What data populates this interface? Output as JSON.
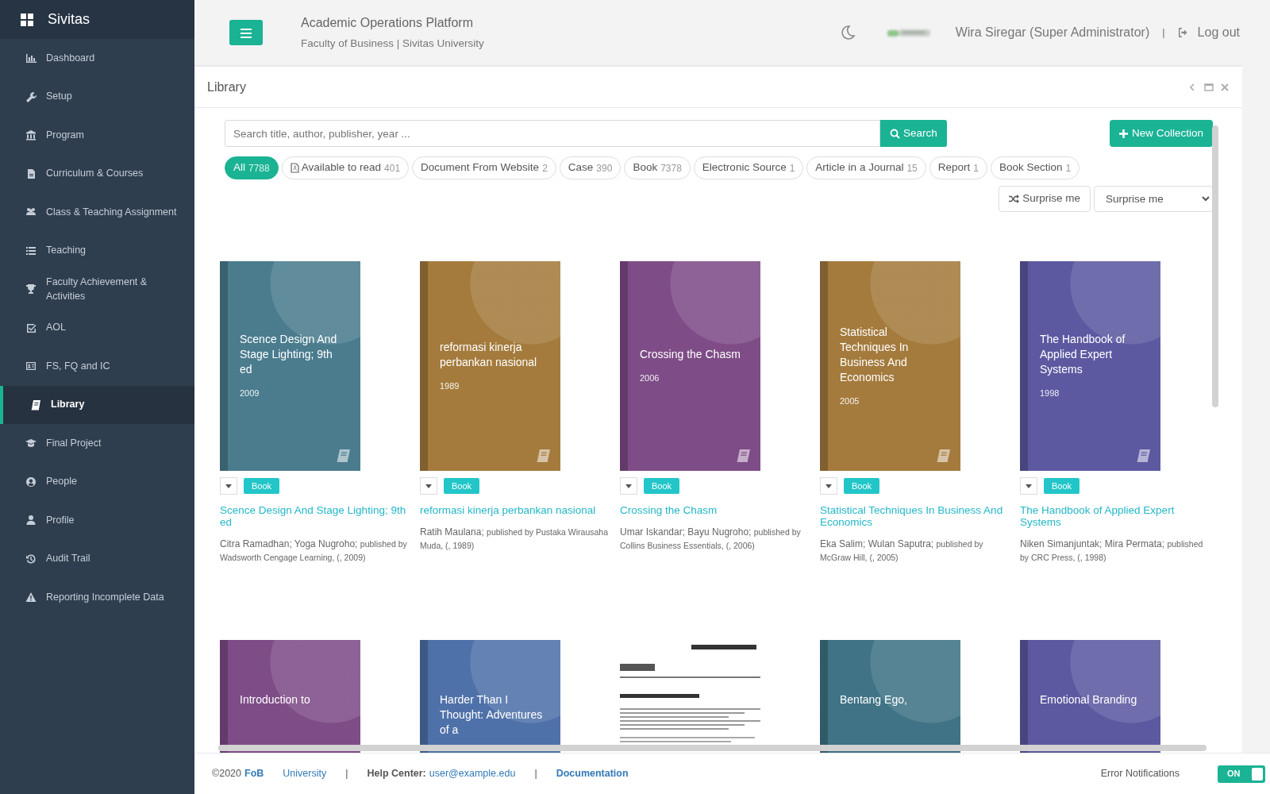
{
  "brand": "Sivitas",
  "sidebar": {
    "items": [
      {
        "label": "Dashboard",
        "selected": false
      },
      {
        "label": "Setup",
        "selected": false
      },
      {
        "label": "Program",
        "selected": false
      },
      {
        "label": "Curriculum & Courses",
        "selected": false
      },
      {
        "label": "Class & Teaching Assignment",
        "selected": false
      },
      {
        "label": "Teaching",
        "selected": false
      },
      {
        "label": "Faculty Achievement & Activities",
        "selected": false
      },
      {
        "label": "AOL",
        "selected": false
      },
      {
        "label": "FS, FQ and IC",
        "selected": false
      },
      {
        "label": "Library",
        "selected": true
      },
      {
        "label": "Final Project",
        "selected": false
      },
      {
        "label": "People",
        "selected": false
      },
      {
        "label": "Profile",
        "selected": false
      },
      {
        "label": "Audit Trail",
        "selected": false
      },
      {
        "label": "Reporting Incomplete Data",
        "selected": false
      }
    ]
  },
  "header": {
    "title": "Academic Operations Platform",
    "subtitle": "Faculty of Business | Sivitas University",
    "user": "Wira Siregar (Super Administrator)",
    "separator": "|",
    "logout": "Log out"
  },
  "panel": {
    "title": "Library"
  },
  "search": {
    "placeholder": "Search title, author, publisher, year ...",
    "button": "Search"
  },
  "new_collection": "New Collection",
  "filters": [
    {
      "label": "All",
      "count": "7788",
      "selected": true
    },
    {
      "label": "Available to read",
      "count": "401",
      "selected": false
    },
    {
      "label": "Document From Website",
      "count": "2",
      "selected": false
    },
    {
      "label": "Case",
      "count": "390",
      "selected": false
    },
    {
      "label": "Book",
      "count": "7378",
      "selected": false
    },
    {
      "label": "Electronic Source",
      "count": "1",
      "selected": false
    },
    {
      "label": "Article in a Journal",
      "count": "15",
      "selected": false
    },
    {
      "label": "Report",
      "count": "1",
      "selected": false
    },
    {
      "label": "Book Section",
      "count": "1",
      "selected": false
    }
  ],
  "surprise": {
    "button": "Surprise me",
    "select": "Surprise me"
  },
  "books": [
    {
      "kind": "cover",
      "color": "#4a7c8e",
      "cover_title": "Scence Design And Stage Lighting; 9th ed",
      "year": "2009",
      "type": "Book",
      "title": "Scence Design And Stage Lighting; 9th ed",
      "authors": "Citra Ramadhan; Yoga Nugroho;",
      "publisher": "published by Wadsworth Cengage Learning, (, 2009)"
    },
    {
      "kind": "cover",
      "color": "#a47b3d",
      "cover_title": "reformasi kinerja perbankan nasional",
      "year": "1989",
      "type": "Book",
      "title": "reformasi kinerja perbankan nasional",
      "authors": "Ratih Maulana;",
      "publisher": "published by Pustaka Wirausaha Muda, (, 1989)"
    },
    {
      "kind": "cover",
      "color": "#7e4c87",
      "cover_title": "Crossing the Chasm",
      "year": "2006",
      "type": "Book",
      "title": "Crossing the Chasm",
      "authors": "Umar Iskandar; Bayu Nugroho;",
      "publisher": "published by Collins Business Essentials, (, 2006)"
    },
    {
      "kind": "cover",
      "color": "#a47b3d",
      "cover_title": "Statistical Techniques In Business And Economics",
      "year": "2005",
      "type": "Book",
      "title": "Statistical Techniques In Business And Economics",
      "authors": "Eka Salim; Wulan Saputra;",
      "publisher": "published by McGraw Hill, (, 2005)"
    },
    {
      "kind": "cover",
      "color": "#5c59a1",
      "cover_title": "The Handbook of Applied Expert Systems",
      "year": "1998",
      "type": "Book",
      "title": "The Handbook of Applied Expert Systems",
      "authors": "Niken Simanjuntak; Mira Permata;",
      "publisher": "published by CRC Press, (, 1998)"
    },
    {
      "kind": "cover",
      "color": "#7e4c87",
      "cover_title": "Introduction to"
    },
    {
      "kind": "cover",
      "color": "#4f71a9",
      "cover_title": "Harder Than I Thought: Adventures of a"
    },
    {
      "kind": "picture"
    },
    {
      "kind": "cover",
      "color": "#3f7385",
      "cover_title": "Bentang Ego,"
    },
    {
      "kind": "cover",
      "color": "#5c59a1",
      "cover_title": "Emotional Branding"
    }
  ],
  "footer": {
    "copyright": "©2020",
    "org": "FoB",
    "university": "University",
    "sep1": "|",
    "help_label": "Help Center:",
    "help_email": "user@example.edu",
    "sep2": "|",
    "docs": "Documentation",
    "notifications_label": "Error Notifications",
    "notifications": {
      "on": true,
      "label": "ON"
    }
  }
}
